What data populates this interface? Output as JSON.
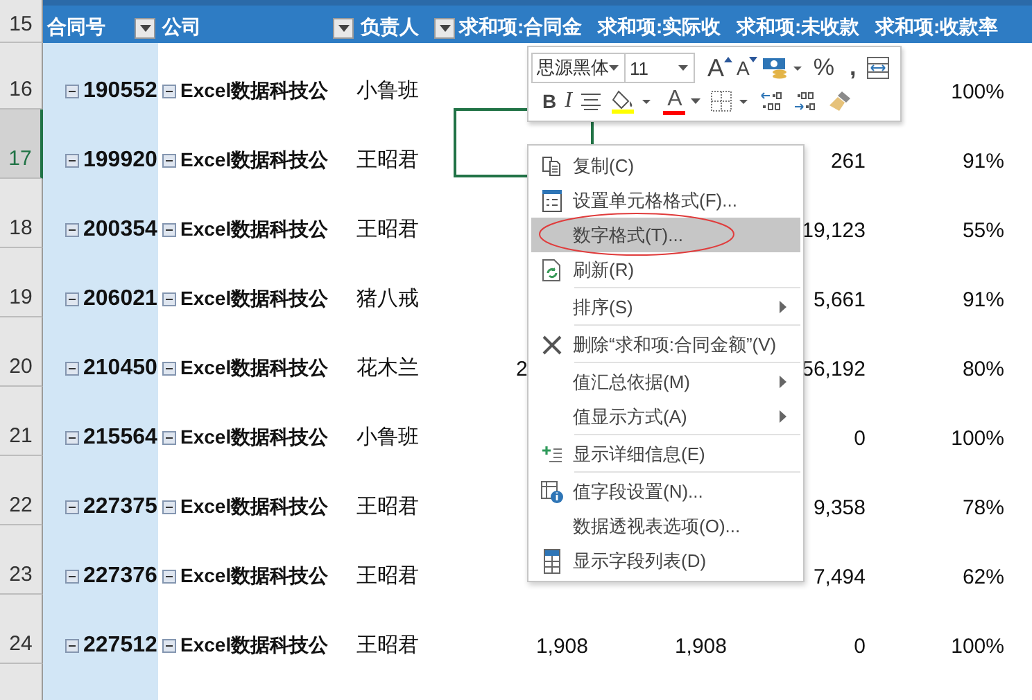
{
  "table": {
    "header_row_number": "15",
    "columns": [
      {
        "label": "合同号",
        "filter": true
      },
      {
        "label": "公司",
        "filter": true
      },
      {
        "label": "负责人",
        "filter": true
      },
      {
        "label": "求和项:合同金",
        "filter": false
      },
      {
        "label": "求和项:实际收",
        "filter": false
      },
      {
        "label": "求和项:未收款",
        "filter": false
      },
      {
        "label": "求和项:收款率",
        "filter": false
      }
    ],
    "rows": [
      {
        "row_number": "16",
        "selected": false,
        "contract": "190552",
        "company": "Excel数据科技公",
        "owner": "小鲁班",
        "rate": "100%"
      },
      {
        "row_number": "17",
        "selected": true,
        "contract": "199920",
        "company": "Excel数据科技公",
        "owner": "王昭君",
        "unpaid": "261",
        "rate": "91%"
      },
      {
        "row_number": "18",
        "selected": false,
        "contract": "200354",
        "company": "Excel数据科技公",
        "owner": "王昭君",
        "unpaid": "19,123",
        "rate": "55%"
      },
      {
        "row_number": "19",
        "selected": false,
        "contract": "206021",
        "company": "Excel数据科技公",
        "owner": "猪八戒",
        "unpaid": "5,661",
        "rate": "91%"
      },
      {
        "row_number": "20",
        "selected": false,
        "contract": "210450",
        "company": "Excel数据科技公",
        "owner": "花木兰",
        "amount": "2",
        "amount_clipped": true,
        "unpaid": "56,192",
        "rate": "80%"
      },
      {
        "row_number": "21",
        "selected": false,
        "contract": "215564",
        "company": "Excel数据科技公",
        "owner": "小鲁班",
        "unpaid": "0",
        "rate": "100%"
      },
      {
        "row_number": "22",
        "selected": false,
        "contract": "227375",
        "company": "Excel数据科技公",
        "owner": "王昭君",
        "unpaid": "9,358",
        "rate": "78%"
      },
      {
        "row_number": "23",
        "selected": false,
        "contract": "227376",
        "company": "Excel数据科技公",
        "owner": "王昭君",
        "unpaid": "7,494",
        "rate": "62%"
      },
      {
        "row_number": "24",
        "selected": false,
        "contract": "227512",
        "company": "Excel数据科技公",
        "owner": "王昭君",
        "amount": "1,908",
        "amount_clipped": false,
        "received": "1,908",
        "unpaid": "0",
        "rate": "100%"
      }
    ]
  },
  "mini_toolbar": {
    "row_1": [
      {
        "kind": "font",
        "value": "思源黑体"
      },
      {
        "kind": "size",
        "value": "11"
      },
      {
        "kind": "grow",
        "label": "A"
      },
      {
        "kind": "shrink",
        "label": "A"
      },
      {
        "kind": "currency"
      },
      {
        "kind": "percent",
        "label": "%"
      },
      {
        "kind": "comma",
        "label": ","
      },
      {
        "kind": "table"
      }
    ],
    "row_2": [
      {
        "kind": "bold",
        "label": "B"
      },
      {
        "kind": "italic",
        "label": "I"
      },
      {
        "kind": "align"
      },
      {
        "kind": "fill",
        "color": "#ffff00"
      },
      {
        "kind": "fontcolor",
        "label": "A",
        "color": "#ff0000"
      },
      {
        "kind": "borders"
      },
      {
        "kind": "incdec"
      },
      {
        "kind": "decdec"
      },
      {
        "kind": "painter"
      }
    ]
  },
  "context_menu": {
    "groups": [
      [
        {
          "label": "复制(C)",
          "submenu": false,
          "selected": false,
          "circled": false
        },
        {
          "label": "设置单元格格式(F)...",
          "submenu": false,
          "selected": false,
          "circled": false
        },
        {
          "label": "数字格式(T)...",
          "submenu": false,
          "selected": true,
          "circled": true
        },
        {
          "label": "刷新(R)",
          "submenu": false,
          "selected": false,
          "circled": false
        }
      ],
      [
        {
          "label": "排序(S)",
          "submenu": true,
          "selected": false,
          "circled": false
        }
      ],
      [
        {
          "label": "删除“求和项:合同金额”(V)",
          "submenu": false,
          "selected": false,
          "circled": false
        }
      ],
      [
        {
          "label": "值汇总依据(M)",
          "submenu": true,
          "selected": false,
          "circled": false
        },
        {
          "label": "值显示方式(A)",
          "submenu": true,
          "selected": false,
          "circled": false
        }
      ],
      [
        {
          "label": "显示详细信息(E)",
          "submenu": false,
          "selected": false,
          "circled": false
        }
      ],
      [
        {
          "label": "值字段设置(N)...",
          "submenu": false,
          "selected": false,
          "circled": false
        },
        {
          "label": "数据透视表选项(O)...",
          "submenu": false,
          "selected": false,
          "circled": false
        },
        {
          "label": "显示字段列表(D)",
          "submenu": false,
          "selected": false,
          "circled": false
        }
      ]
    ]
  }
}
